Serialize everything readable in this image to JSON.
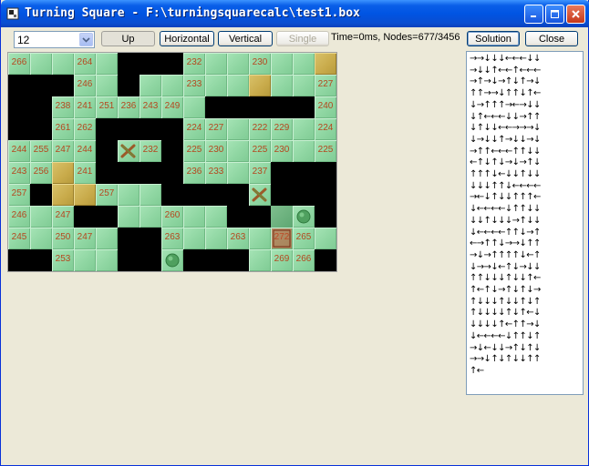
{
  "window": {
    "title": "Turning Square - F:\\turningsquarecalc\\test1.box"
  },
  "toolbar": {
    "level_value": "12",
    "up_label": "Up",
    "horizontal_label": "Horizontal",
    "vertical_label": "Vertical",
    "single_label": "Single",
    "solution_label": "Solution",
    "close_label": "Close"
  },
  "status": {
    "text": "Time=0ms, Nodes=677/3456"
  },
  "board": {
    "cols": 15,
    "rows": 10,
    "grid": [
      "FFFFFXXXFFFFFFG",
      "XXXFFXFFFFFGFFF",
      "XXFFFFFFFXXXXXF",
      "XXFFXXXXFFFFFFF",
      "FFFFXFFXFFFFFFF",
      "FFGFXXXXFFFFXXX",
      "FXGGFFFXXXXFXXX",
      "FFFXXFFFFFXXDFX",
      "FFFFFXXFFFFFFFF",
      "XXFFFXXFXXXFFFX"
    ],
    "labels": [
      {
        "r": 0,
        "c": 0,
        "t": "266"
      },
      {
        "r": 0,
        "c": 3,
        "t": "264"
      },
      {
        "r": 0,
        "c": 8,
        "t": "232"
      },
      {
        "r": 0,
        "c": 11,
        "t": "230"
      },
      {
        "r": 1,
        "c": 3,
        "t": "246"
      },
      {
        "r": 1,
        "c": 8,
        "t": "233"
      },
      {
        "r": 1,
        "c": 14,
        "t": "227"
      },
      {
        "r": 2,
        "c": 2,
        "t": "238"
      },
      {
        "r": 2,
        "c": 3,
        "t": "241"
      },
      {
        "r": 2,
        "c": 4,
        "t": "251"
      },
      {
        "r": 2,
        "c": 5,
        "t": "236"
      },
      {
        "r": 2,
        "c": 6,
        "t": "243"
      },
      {
        "r": 2,
        "c": 7,
        "t": "249"
      },
      {
        "r": 2,
        "c": 14,
        "t": "240"
      },
      {
        "r": 3,
        "c": 2,
        "t": "261"
      },
      {
        "r": 3,
        "c": 3,
        "t": "262"
      },
      {
        "r": 3,
        "c": 8,
        "t": "224"
      },
      {
        "r": 3,
        "c": 9,
        "t": "227"
      },
      {
        "r": 3,
        "c": 11,
        "t": "222"
      },
      {
        "r": 3,
        "c": 12,
        "t": "229"
      },
      {
        "r": 3,
        "c": 14,
        "t": "224"
      },
      {
        "r": 4,
        "c": 0,
        "t": "244"
      },
      {
        "r": 4,
        "c": 1,
        "t": "255"
      },
      {
        "r": 4,
        "c": 2,
        "t": "247"
      },
      {
        "r": 4,
        "c": 3,
        "t": "244"
      },
      {
        "r": 4,
        "c": 6,
        "t": "232"
      },
      {
        "r": 4,
        "c": 8,
        "t": "225"
      },
      {
        "r": 4,
        "c": 9,
        "t": "230"
      },
      {
        "r": 4,
        "c": 11,
        "t": "225"
      },
      {
        "r": 4,
        "c": 12,
        "t": "230"
      },
      {
        "r": 4,
        "c": 14,
        "t": "225"
      },
      {
        "r": 5,
        "c": 0,
        "t": "243"
      },
      {
        "r": 5,
        "c": 1,
        "t": "256"
      },
      {
        "r": 5,
        "c": 3,
        "t": "241"
      },
      {
        "r": 5,
        "c": 8,
        "t": "236"
      },
      {
        "r": 5,
        "c": 9,
        "t": "233"
      },
      {
        "r": 5,
        "c": 11,
        "t": "237"
      },
      {
        "r": 6,
        "c": 0,
        "t": "257"
      },
      {
        "r": 6,
        "c": 4,
        "t": "257"
      },
      {
        "r": 7,
        "c": 0,
        "t": "246"
      },
      {
        "r": 7,
        "c": 2,
        "t": "247"
      },
      {
        "r": 7,
        "c": 7,
        "t": "260"
      },
      {
        "r": 8,
        "c": 0,
        "t": "245"
      },
      {
        "r": 8,
        "c": 2,
        "t": "250"
      },
      {
        "r": 8,
        "c": 3,
        "t": "247"
      },
      {
        "r": 8,
        "c": 7,
        "t": "263"
      },
      {
        "r": 8,
        "c": 10,
        "t": "263"
      },
      {
        "r": 8,
        "c": 12,
        "t": "272"
      },
      {
        "r": 8,
        "c": 13,
        "t": "265"
      },
      {
        "r": 9,
        "c": 2,
        "t": "253"
      },
      {
        "r": 9,
        "c": 12,
        "t": "269"
      },
      {
        "r": 9,
        "c": 13,
        "t": "266"
      }
    ],
    "pieces": [
      {
        "r": 4,
        "c": 5,
        "kind": "turning-square-icon"
      },
      {
        "r": 6,
        "c": 11,
        "kind": "turning-square-icon"
      },
      {
        "r": 7,
        "c": 13,
        "kind": "ball-icon"
      },
      {
        "r": 9,
        "c": 7,
        "kind": "ball-icon"
      },
      {
        "r": 8,
        "c": 12,
        "kind": "player-square-icon"
      }
    ]
  },
  "solution": {
    "lines": [
      "→→↓↓↓←←←↓↓",
      "→↓↓↑←←↑←←←",
      "→↑→↓→↑↓↑→↓",
      "↑↑→→↓↑↑↓↑←",
      "↓→↑↑↑→←→↓↓",
      "↓↑←←←↓↓→↑↑",
      "↓↑↓↓←←→→→↓",
      "↓→↓↓↑→↓↓→↓",
      "→↑↑←←←↑↑↓↓",
      "←↑↓↑↓→↓→↑↓",
      "↑↑↑↓←↓↓↑↓↓",
      "↓↓↓↑↑↓←←←←",
      "→←↓↑↓↓↑↑↑←",
      "↓←←←←↓↑↑↓↓",
      "↓↓↑↓↓↓→↑↓↓",
      "↓←←←←↑↑↓→↑",
      "←→↑↑↓→→↓↑↑",
      "→↓→↑↑↑↑↓←↑",
      "↓→→↓←↑↓→↓↓",
      "↑↑↓↓↓↑↓↓↑←",
      "↑←↑↓→↑↓↑↓→",
      "↑↓↓↓↑↓↓↑↓↑",
      "↑↓↓↓↓↑↓↑←↓",
      "↓↓↓↓↑←↑↑→↓",
      "↓←←←←↓↑↑↓↑",
      "→↓←↓↓→↑↓↑↓",
      "→→↓↑↓↑↓↓↑↑",
      "↑←"
    ]
  },
  "colors": {
    "titlebar": "#0054e3",
    "floor": "#8fd6a2",
    "goal": "#c8aa4a",
    "wall": "#000000",
    "number": "#b5471e"
  }
}
